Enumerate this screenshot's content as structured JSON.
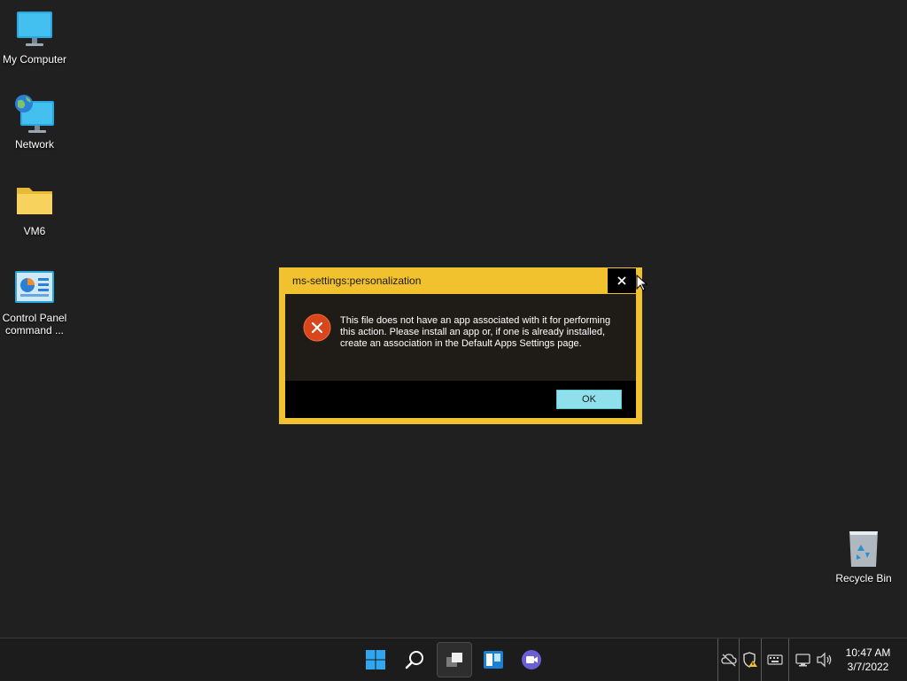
{
  "desktop": {
    "icons": [
      {
        "label": "My Computer",
        "icon": "monitor-icon"
      },
      {
        "label": "Network",
        "icon": "network-icon"
      },
      {
        "label": "VM6",
        "icon": "folder-icon"
      },
      {
        "label": "Control Panel command ...",
        "icon": "control-panel-icon"
      },
      {
        "label": "Recycle Bin",
        "icon": "recycle-bin-icon"
      }
    ]
  },
  "dialog": {
    "title": "ms-settings:personalization",
    "message": "This file does not have an app associated with it for performing this action. Please install an app or, if one is already installed, create an association in the Default Apps Settings page.",
    "ok_label": "OK",
    "close_glyph": "✕",
    "accent_color": "#f2c12e"
  },
  "taskbar": {
    "buttons": [
      {
        "name": "start",
        "icon": "windows-logo-icon"
      },
      {
        "name": "search",
        "icon": "search-icon"
      },
      {
        "name": "task-view",
        "icon": "task-view-icon",
        "active": true
      },
      {
        "name": "widgets",
        "icon": "widgets-icon"
      },
      {
        "name": "teams-chat",
        "icon": "video-chat-icon"
      }
    ],
    "tray": {
      "icons": [
        "cloud-offline-icon",
        "security-warning-icon",
        "keyboard-icon",
        "network-status-icon",
        "volume-icon"
      ]
    },
    "clock": {
      "time": "10:47 AM",
      "date": "3/7/2022"
    }
  }
}
